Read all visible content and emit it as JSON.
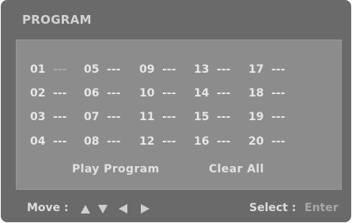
{
  "title": "PROGRAM",
  "slots": [
    [
      "01",
      "05",
      "09",
      "13",
      "17"
    ],
    [
      "02",
      "06",
      "10",
      "14",
      "18"
    ],
    [
      "03",
      "07",
      "11",
      "15",
      "19"
    ],
    [
      "04",
      "08",
      "12",
      "16",
      "20"
    ]
  ],
  "empty_marker": "---",
  "actions": {
    "play": "Play Program",
    "clear": "Clear All"
  },
  "footer": {
    "move_label": "Move :",
    "select_label": "Select :",
    "select_value": "Enter"
  },
  "icons": [
    "arrow-up-icon",
    "arrow-down-icon",
    "arrow-left-icon",
    "arrow-right-icon"
  ],
  "colors": {
    "background": "#6a6a6a",
    "panel": "#8c8c8c",
    "text": "#e6e6e6"
  }
}
